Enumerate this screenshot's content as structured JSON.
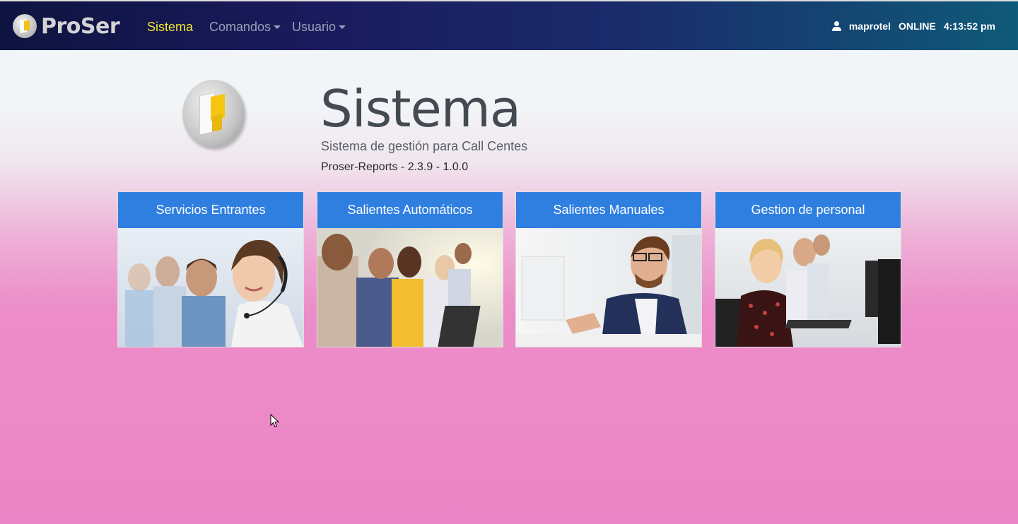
{
  "navbar": {
    "brand": "ProSer",
    "links": [
      {
        "label": "Sistema",
        "active": true
      },
      {
        "label": "Comandos",
        "dropdown": true
      },
      {
        "label": "Usuario",
        "dropdown": true
      }
    ],
    "user": "maprotel",
    "status": "ONLINE",
    "time": "4:13:52 pm"
  },
  "hero": {
    "title": "Sistema",
    "subtitle": "Sistema de gestión para Call Centes",
    "version": "Proser-Reports - 2.3.9 - 1.0.0"
  },
  "cards": [
    {
      "label": "Servicios Entrantes",
      "image": "agent-headset-woman-photo"
    },
    {
      "label": "Salientes Automáticos",
      "image": "call-center-team-photo"
    },
    {
      "label": "Salientes Manuales",
      "image": "agent-man-glasses-photo"
    },
    {
      "label": "Gestion de personal",
      "image": "agents-row-monitors-photo"
    }
  ],
  "colors": {
    "navbar": "#1a1a5c",
    "active_link": "#f6e630",
    "card_header": "#2f7fe0",
    "page_bottom": "#ec86c6"
  }
}
